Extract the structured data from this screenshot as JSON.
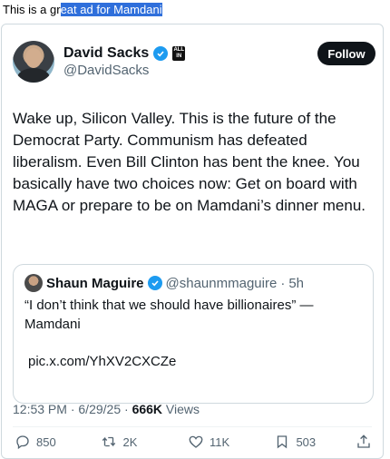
{
  "caption": {
    "prefix": "This is a gr",
    "selected": "eat ad for Mamdani"
  },
  "tweet": {
    "author_name": "David Sacks",
    "affiliation_badge": "ALL IN",
    "handle": "@DavidSacks",
    "follow_label": "Follow",
    "text": "Wake up, Silicon Valley. This is the future of the Democrat Party. Communism has defeated liberalism. Even Bill Clinton has bent the knee. You basically have two choices now: Get on board with MAGA or prepare to be on Mamdani’s dinner menu.",
    "quote": {
      "author_name": "Shaun Maguire",
      "handle": "@shaunmmaguire",
      "separator": "·",
      "time": "5h",
      "text": "“I don’t think that we should have billionaires” — Mamdani",
      "link": "pic.x.com/YhXV2CXCZe"
    },
    "time": "12:53 PM",
    "date": "6/29/25",
    "views_count": "666K",
    "views_label": "Views",
    "replies": "850",
    "reposts": "2K",
    "likes": "11K",
    "bookmarks": "503"
  },
  "colors": {
    "verified_blue": "#1d9bf0",
    "muted_text": "#536471",
    "selection": "#2f6fdb"
  },
  "icons": [
    "verified-badge-icon",
    "reply-icon",
    "repost-icon",
    "like-icon",
    "bookmark-icon",
    "share-icon"
  ]
}
